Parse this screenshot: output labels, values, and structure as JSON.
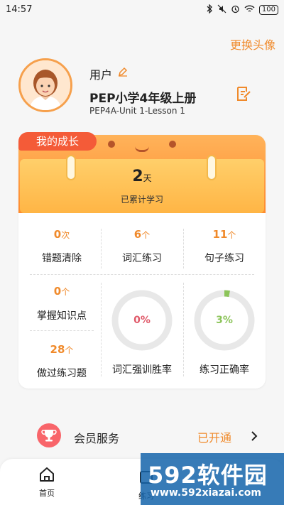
{
  "status_bar": {
    "time": "14:57",
    "battery": "100"
  },
  "header": {
    "change_avatar": "更换头像"
  },
  "profile": {
    "name": "用户",
    "book": "PEP小学4年级上册",
    "lesson": "PEP4A-Unit 1-Lesson 1"
  },
  "growth": {
    "tab_label": "我的成长",
    "days": "2",
    "days_unit": "天",
    "days_label": "已累计学习",
    "stats": {
      "wrong": {
        "value": "0",
        "unit": "次",
        "label": "错题清除"
      },
      "vocab": {
        "value": "6",
        "unit": "个",
        "label": "词汇练习"
      },
      "sentence": {
        "value": "11",
        "unit": "个",
        "label": "句子练习"
      },
      "mastered": {
        "value": "0",
        "unit": "个",
        "label": "掌握知识点"
      },
      "done": {
        "value": "28",
        "unit": "个",
        "label": "做过练习题"
      }
    },
    "vocab_win_rate": {
      "text": "0%",
      "value": 0,
      "label": "词汇强训胜率",
      "color": "#e05a6a"
    },
    "accuracy": {
      "text": "3%",
      "value": 3,
      "label": "练习正确率",
      "color": "#8cc45a"
    }
  },
  "member": {
    "label": "会员服务",
    "status": "已开通"
  },
  "tabs": {
    "home": "首页",
    "practice": "练习"
  },
  "watermark": {
    "brand_num": "592",
    "brand_text": "软件园",
    "url": "www.592xiazai.com"
  },
  "colors": {
    "accent": "#f08a2b",
    "red_tab": "#f45b38"
  }
}
